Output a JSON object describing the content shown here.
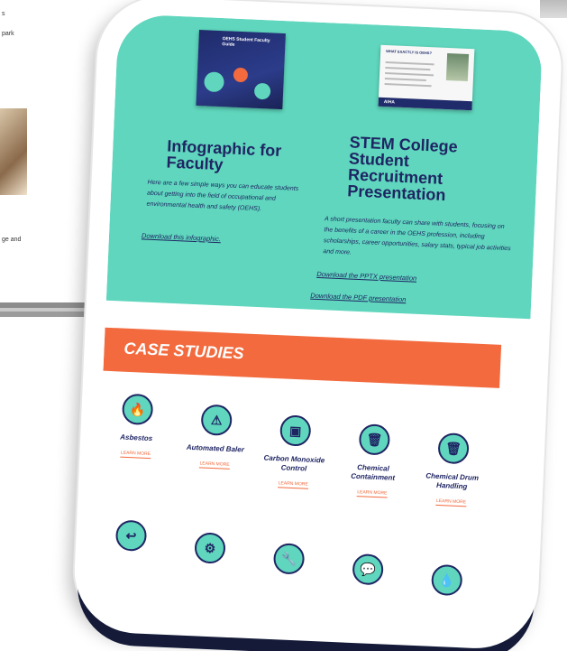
{
  "background_page": {
    "text_lines": [
      "s",
      "",
      "park"
    ],
    "trailing_text": "ge and"
  },
  "faculty": {
    "title": "Infographic for Faculty",
    "body": "Here are a few simple ways you can educate students about getting into the field of occupational and environmental health and safety (OEHS).",
    "link": "Download this infographic.",
    "thumbnail_title": "OEHS Student Faculty Guide"
  },
  "stem": {
    "title": "STEM College Student Recruitment Presentation",
    "body": "A short presentation faculty can share with students, focusing on the benefits of a career in the OEHS profession, including scholarships, career opportunities, salary stats, typical job activities and more.",
    "link_pptx": "Download the PPTX presentation",
    "link_pdf": "Download the PDF presentation",
    "thumbnail_title": "WHAT EXACTLY IS OEHS?",
    "thumbnail_logo": "AIHA"
  },
  "case_studies": {
    "heading": "CASE STUDIES",
    "items": [
      {
        "title": "Asbestos",
        "link": "LEARN MORE",
        "icon": "flame-icon",
        "glyph": "🔥"
      },
      {
        "title": "Automated Baler",
        "link": "LEARN MORE",
        "icon": "warning-icon",
        "glyph": "⚠"
      },
      {
        "title": "Carbon Monoxide Control",
        "link": "LEARN MORE",
        "icon": "panel-icon",
        "glyph": "▣"
      },
      {
        "title": "Chemical Containment",
        "link": "LEARN MORE",
        "icon": "trash-icon",
        "glyph": "🗑"
      },
      {
        "title": "Chemical Drum Handling",
        "link": "LEARN MORE",
        "icon": "bin-icon",
        "glyph": "🗑"
      }
    ],
    "next_row_icons": [
      {
        "icon": "return-arrow-icon",
        "glyph": "↩"
      },
      {
        "icon": "gear-icon",
        "glyph": "⚙"
      },
      {
        "icon": "wrench-icon",
        "glyph": "🔧"
      },
      {
        "icon": "chat-icon",
        "glyph": "💬"
      },
      {
        "icon": "drop-icon",
        "glyph": "💧"
      }
    ]
  },
  "colors": {
    "teal": "#5fd6bd",
    "navy": "#1f2563",
    "orange": "#f26a3d"
  }
}
